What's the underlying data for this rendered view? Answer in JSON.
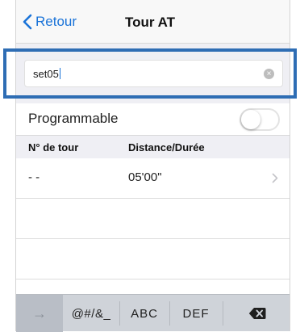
{
  "nav": {
    "back_label": "Retour",
    "title": "Tour AT"
  },
  "search": {
    "value": "set05"
  },
  "programmable": {
    "label": "Programmable",
    "enabled": false
  },
  "table": {
    "headers": [
      "N° de tour",
      "Distance/Durée"
    ],
    "rows": [
      {
        "tour": "- -",
        "distance": "05'00\""
      }
    ]
  },
  "keyboard": {
    "keys": [
      "→",
      "@#/&_",
      "ABC",
      "DEF"
    ],
    "delete_icon": "backspace-icon"
  },
  "colors": {
    "accent": "#1a73d8",
    "highlight": "#2e6db4"
  }
}
